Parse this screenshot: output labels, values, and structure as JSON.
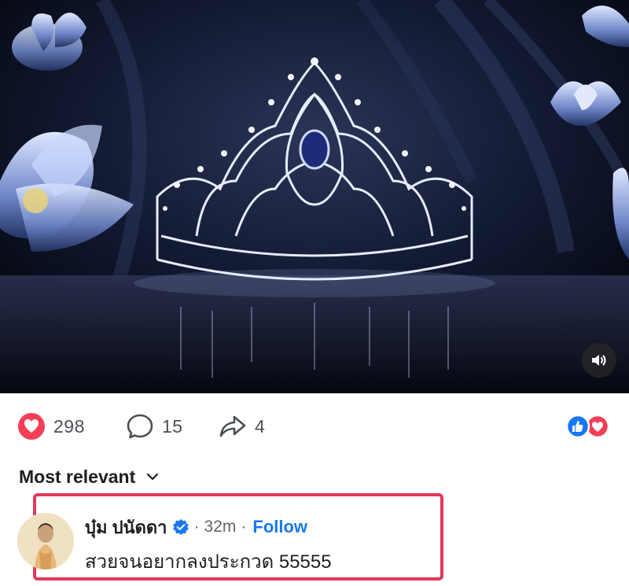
{
  "post": {
    "media": {
      "alt_subject": "crown on dark stage with blue lotus flowers",
      "sound_icon": "speaker-icon"
    },
    "stats": {
      "reactions_count": "298",
      "comments_count": "15",
      "shares_count": "4",
      "reaction_icons": [
        "like-icon",
        "love-icon"
      ]
    }
  },
  "comments": {
    "sort_label": "Most relevant",
    "items": [
      {
        "author": "บุ๋ม ปนัดดา",
        "verified": true,
        "time": "32m",
        "separator": "·",
        "follow_label": "Follow",
        "text": "สวยจนอยากลงประกวด 55555"
      }
    ]
  },
  "colors": {
    "highlight": "#e0395a",
    "link": "#1877f2",
    "love": "#f33e58",
    "like": "#1877f2"
  }
}
